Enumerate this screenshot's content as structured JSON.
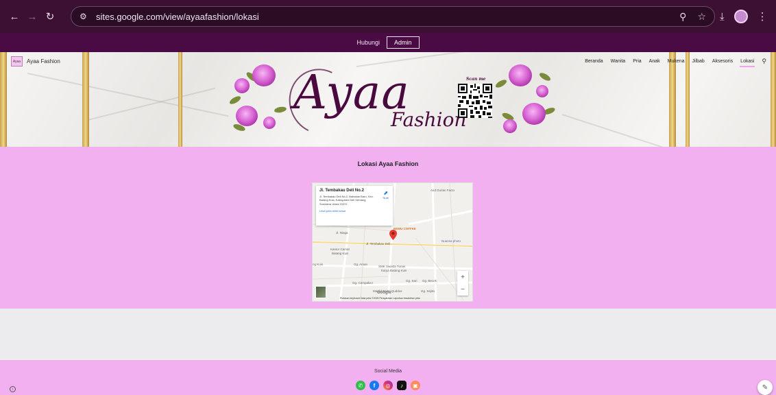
{
  "browser": {
    "url": "sites.google.com/view/ayaafashion/lokasi",
    "icons": {
      "back": "back-arrow-icon",
      "forward": "forward-arrow-icon",
      "reload": "reload-icon",
      "tune": "site-info-icon",
      "zoom": "zoom-icon",
      "bookmark": "star-icon",
      "download": "download-icon",
      "menu": "kebab-menu-icon"
    }
  },
  "announcement": {
    "text": "Hubungi",
    "admin_label": "Admin"
  },
  "header": {
    "site_name": "Ayaa Fashion",
    "logo_badge": "Ayaa",
    "hero_title": "Ayaa",
    "hero_subtitle": "Fashion",
    "scan_label": "Scan me",
    "nav": [
      {
        "label": "Beranda"
      },
      {
        "label": "Wanita"
      },
      {
        "label": "Pria"
      },
      {
        "label": "Anak"
      },
      {
        "label": "Mukena"
      },
      {
        "label": "Jilbab"
      },
      {
        "label": "Aksesoris"
      },
      {
        "label": "Lokasi",
        "active": true
      }
    ]
  },
  "location": {
    "title": "Lokasi Ayaa Fashion",
    "map": {
      "place_title": "Jl. Tembakau Deli No.2",
      "address": "Jl. Tembakau Deli No.2, Bahasan Baru, Kec. Batang Kuis, Kabupaten Deli Serdang, Sumatera Utara 20372",
      "directions_label": "Rute",
      "larger_map_link": "Lihat peta lebih besar",
      "labels": {
        "aird": "Aird Durian Facto",
        "pelita": "Jl. Pelita",
        "niaga": "Jl. Niaga",
        "nemu": "NEMU COFFEE",
        "tembakau": "Jl. Tembakau Deli",
        "nuansa": "Nuansa photo",
        "kantor": "Kantor Camat",
        "batang": "Batang Kuis",
        "kuis": "ng Kuis",
        "aman": "Gg. Aman",
        "smk": "SMK Swasta Tunas",
        "karya": "Karya Batang Kuis",
        "sari": "Gg. Sari",
        "becek": "Gg. Becek",
        "cempaka": "Gg. Cempaka I",
        "masjid": "Masjid Baitul Quddus",
        "sejita": "Gg. Sejita"
      },
      "footer_text": "Pintasan keyboard   Data peta ©2025   Persyaratan   Laporkan kesalahan peta",
      "google": "Google",
      "zoom_in": "+",
      "zoom_out": "−"
    }
  },
  "footer": {
    "title": "Social Media",
    "socials": [
      {
        "icon": "whatsapp-icon",
        "glyph": "✆"
      },
      {
        "icon": "facebook-icon",
        "glyph": "f"
      },
      {
        "icon": "instagram-icon",
        "glyph": "◎"
      },
      {
        "icon": "tiktok-icon",
        "glyph": "♪"
      },
      {
        "icon": "store-icon",
        "glyph": "▣"
      }
    ]
  },
  "colors": {
    "chrome": "#3b1033",
    "announcement": "#4a0a44",
    "section_pink": "#f3b0f1",
    "brand_plum": "#4a0a3f"
  }
}
